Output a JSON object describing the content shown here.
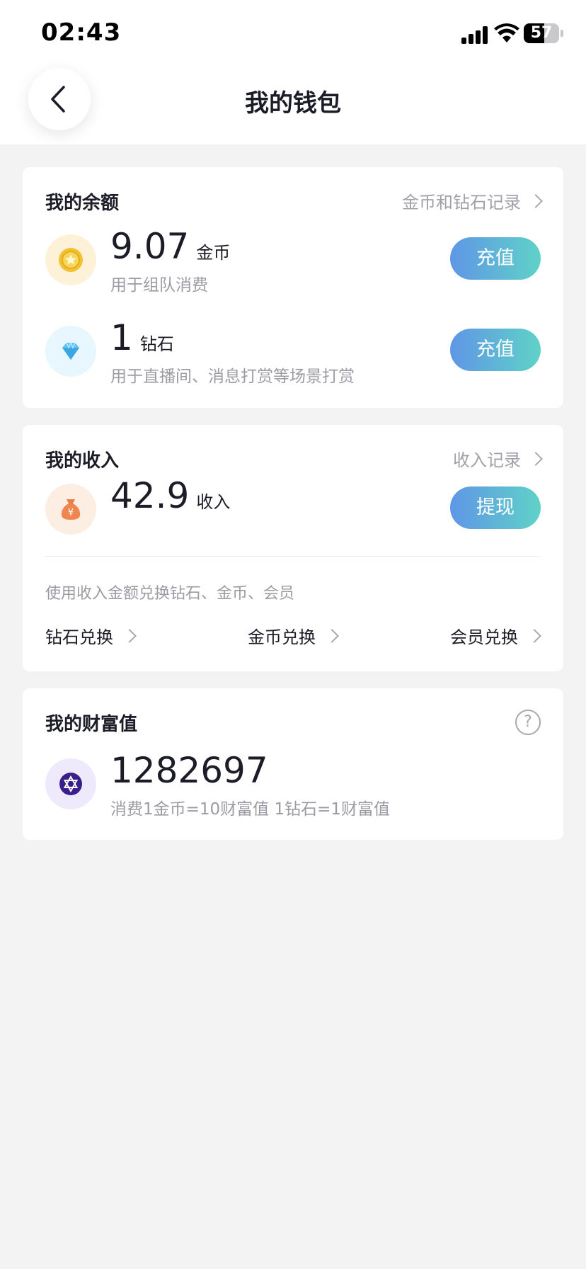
{
  "status_bar": {
    "time": "02:43",
    "battery": "57"
  },
  "header": {
    "title": "我的钱包"
  },
  "balance": {
    "title": "我的余额",
    "link": "金币和钻石记录",
    "coins": {
      "amount": "9.07",
      "unit": "金币",
      "desc": "用于组队消费",
      "button": "充值"
    },
    "diamonds": {
      "amount": "1",
      "unit": "钻石",
      "desc": "用于直播间、消息打赏等场景打赏",
      "button": "充值"
    }
  },
  "income": {
    "title": "我的收入",
    "link": "收入记录",
    "amount": "42.9",
    "unit": "收入",
    "button": "提现",
    "hint": "使用收入金额兑换钻石、金币、会员",
    "exchanges": [
      "钻石兑换",
      "金币兑换",
      "会员兑换"
    ]
  },
  "wealth": {
    "title": "我的财富值",
    "help": "?",
    "value": "1282697",
    "desc": "消费1金币=10财富值 1钻石=1财富值"
  },
  "colors": {
    "accent_start": "#5f96e6",
    "accent_end": "#5fd2c8",
    "background": "#f3f3f4"
  },
  "icons": [
    "back-icon",
    "coin-icon",
    "diamond-icon",
    "money-bag-icon",
    "wealth-star-icon",
    "help-icon",
    "chevron-right-icon"
  ]
}
